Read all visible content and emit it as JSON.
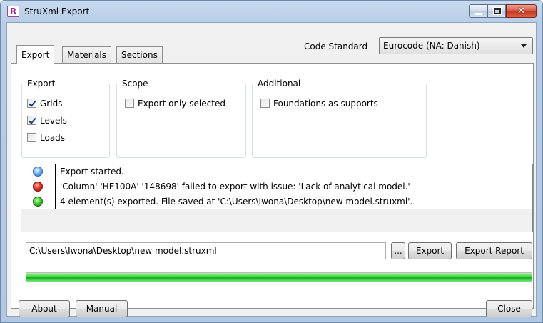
{
  "window": {
    "title": "StruXml Export",
    "app_icon_letter": "R"
  },
  "tabs": [
    {
      "label": "Export",
      "active": true
    },
    {
      "label": "Materials",
      "active": false
    },
    {
      "label": "Sections",
      "active": false
    }
  ],
  "code_standard": {
    "label": "Code Standard",
    "value": "Eurocode (NA: Danish)"
  },
  "groups": {
    "export": {
      "title": "Export",
      "items": [
        {
          "label": "Grids",
          "checked": true
        },
        {
          "label": "Levels",
          "checked": true
        },
        {
          "label": "Loads",
          "checked": false
        }
      ]
    },
    "scope": {
      "title": "Scope",
      "items": [
        {
          "label": "Export only selected",
          "checked": false
        }
      ]
    },
    "additional": {
      "title": "Additional",
      "items": [
        {
          "label": "Foundations as supports",
          "checked": false
        }
      ]
    }
  },
  "log": [
    {
      "status": "info",
      "icon": "blue-circle-icon",
      "color": "#4a90e2",
      "message": "Export started."
    },
    {
      "status": "error",
      "icon": "red-circle-icon",
      "color": "#c0201a",
      "message": "'Column' 'HE100A' '148698' failed to export with issue: 'Lack of analytical model.'"
    },
    {
      "status": "success",
      "icon": "green-circle-icon",
      "color": "#1e9a1e",
      "message": "4 element(s) exported. File saved at 'C:\\Users\\Iwona\\Desktop\\new model.struxml'."
    }
  ],
  "file_path": "C:\\Users\\Iwona\\Desktop\\new model.struxml",
  "buttons": {
    "browse": "...",
    "export": "Export",
    "export_report": "Export Report",
    "about": "About",
    "manual": "Manual",
    "close": "Close"
  },
  "progress": {
    "fraction": 1.0,
    "color": "#06b025"
  }
}
